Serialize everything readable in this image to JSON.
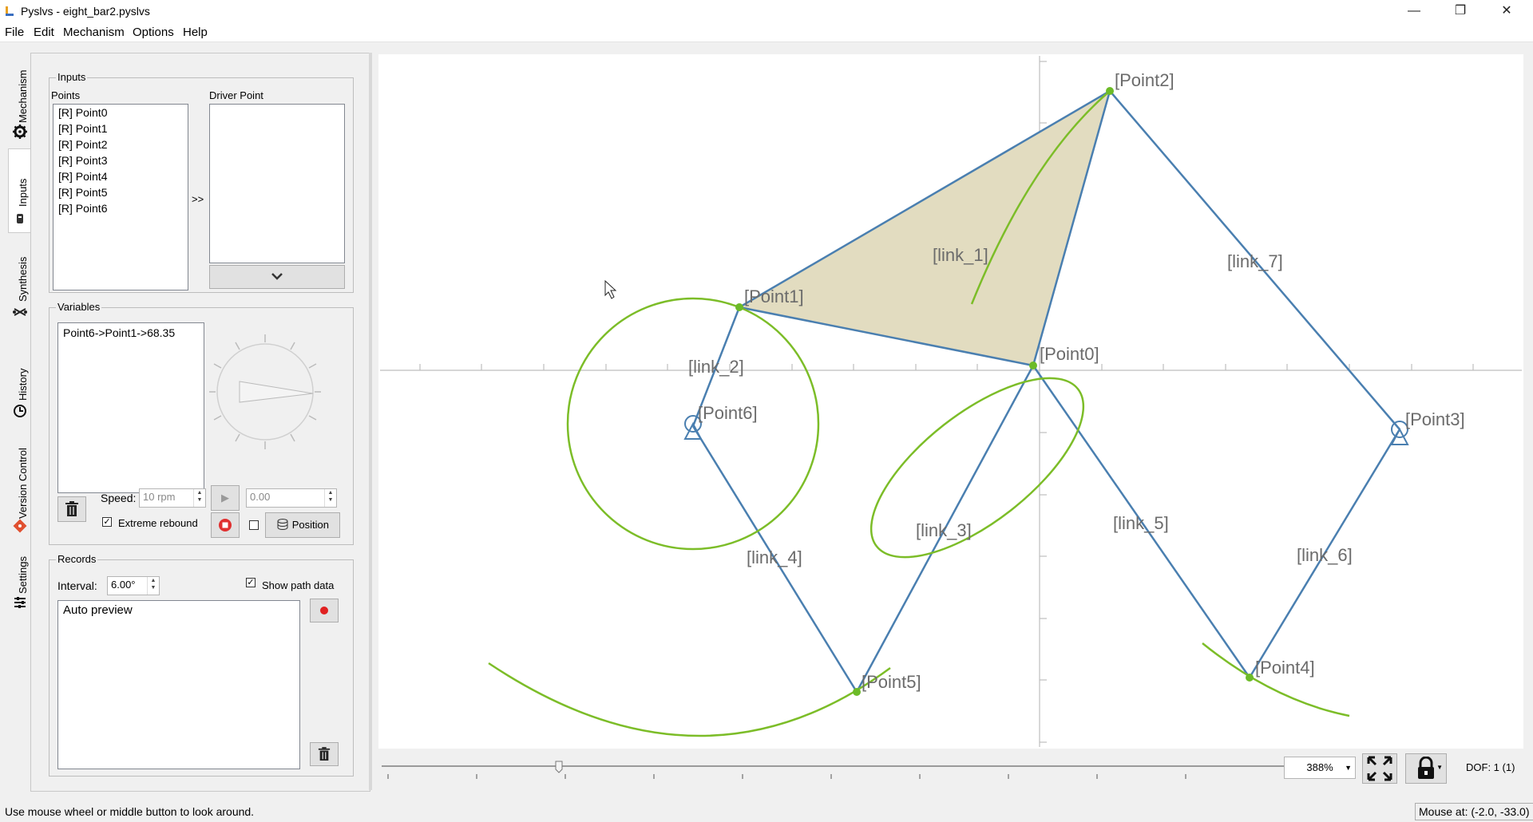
{
  "window": {
    "title": "Pyslvs - eight_bar2.pyslvs",
    "minimize": "—",
    "restore": "❐",
    "close": "✕"
  },
  "menu": [
    "File",
    "Edit",
    "Mechanism",
    "Options",
    "Help"
  ],
  "side_tabs": [
    {
      "label": "Mechanism",
      "icon": "gear-icon"
    },
    {
      "label": "Inputs",
      "icon": "input-icon"
    },
    {
      "label": "Synthesis",
      "icon": "synthesis-icon"
    },
    {
      "label": "History",
      "icon": "clock-icon"
    },
    {
      "label": "Version Control",
      "icon": "git-icon"
    },
    {
      "label": "Settings",
      "icon": "sliders-icon"
    }
  ],
  "inputs": {
    "group_title": "Inputs",
    "points_label": "Points",
    "driver_label": "Driver Point",
    "points": [
      "[R] Point0",
      "[R] Point1",
      "[R] Point2",
      "[R] Point3",
      "[R] Point4",
      "[R] Point5",
      "[R] Point6"
    ],
    "add_button": ">>",
    "driver_points": []
  },
  "variables": {
    "group_title": "Variables",
    "items": [
      "Point6->Point1->68.35"
    ],
    "speed_label": "Speed:",
    "speed_value": "10 rpm",
    "angle_value": "0.00",
    "extreme_rebound_label": "Extreme rebound",
    "extreme_rebound_checked": true,
    "position_label": "Position"
  },
  "records": {
    "group_title": "Records",
    "interval_label": "Interval:",
    "interval_value": "6.00°",
    "show_path_label": "Show path data",
    "show_path_checked": true,
    "items": [
      "Auto preview"
    ]
  },
  "canvas": {
    "point_labels": [
      "[Point0]",
      "[Point1]",
      "[Point2]",
      "[Point3]",
      "[Point4]",
      "[Point5]",
      "[Point6]"
    ],
    "link_labels": [
      "[link_1]",
      "[link_2]",
      "[link_3]",
      "[link_4]",
      "[link_5]",
      "[link_6]",
      "[link_7]"
    ],
    "colors": {
      "link": "#4a7fb0",
      "path": "#7cbd28",
      "joint": "#6cbb28",
      "link_fill": "#e2dcc0"
    }
  },
  "bottom": {
    "zoom": "388%",
    "dof_text": "DOF:  1 (1)"
  },
  "status": {
    "message": "Use mouse wheel or middle button to look around.",
    "mouse_pos": "Mouse at: (-2.0, -33.0)"
  }
}
